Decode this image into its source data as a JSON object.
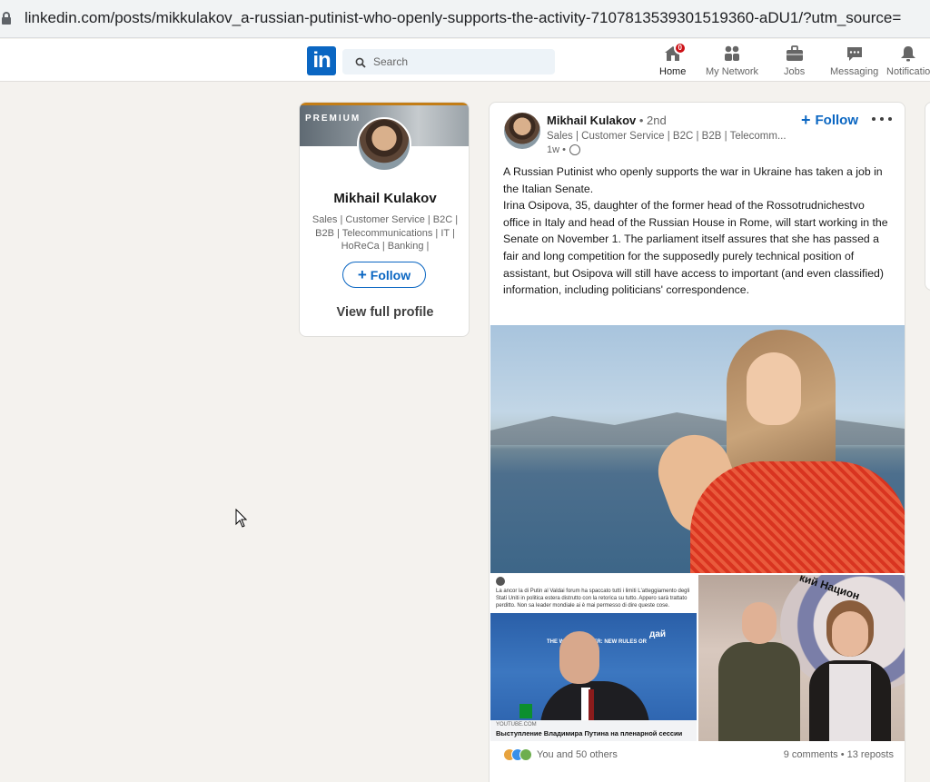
{
  "browser": {
    "url": "linkedin.com/posts/mikkulakov_a-russian-putinist-who-openly-supports-the-activity-7107813539301519360-aDU1/?utm_source="
  },
  "nav": {
    "logo": "in",
    "search_placeholder": "Search",
    "items": [
      {
        "label": "Home",
        "icon": "home-icon",
        "badge": "0"
      },
      {
        "label": "My Network",
        "icon": "network-icon"
      },
      {
        "label": "Jobs",
        "icon": "briefcase-icon"
      },
      {
        "label": "Messaging",
        "icon": "messaging-icon"
      },
      {
        "label": "Notificatio",
        "icon": "bell-icon"
      }
    ]
  },
  "profile_card": {
    "badge": "PREMIUM",
    "name": "Mikhail Kulakov",
    "headline": "Sales | Customer Service | B2C | B2B | Telecommunications | IT | HoReCa | Banking |",
    "follow": "Follow",
    "view_profile": "View full profile"
  },
  "post": {
    "author": "Mikhail Kulakov",
    "degree": "• 2nd",
    "headline": "Sales | Customer Service | B2C | B2B | Telecomm...",
    "time": "1w •",
    "follow": "Follow",
    "text_p1": "A Russian Putinist who openly supports the war in Ukraine has taken a job in the Italian Senate.",
    "text_p2": "Irina Osipova, 35, daughter of the former head of the Rossotrudnichestvo office in Italy and head of the Russian House in Rome, will start working in the Senate on November 1. The parliament itself assures that she has passed a fair and long competition for the supposedly purely technical position of assistant, but Osipova will still have access to important (and even classified) information, including politicians' correspondence.",
    "image2_text": "La ancor la di Putin al Valdai forum ha spaccato tutti i limiti L'atteggiamento degli Stati Uniti in politica estera distrutto con la retorica su tutto. Appero sarà trattato perditto. Non sa leader mondiale ai è mai permesso di dire queste cose.",
    "image2_banner": "THE WORLD ORDER: NEW RULES OR",
    "image2_banner_ru": "дай",
    "image2_source": "YOUTUBE.COM",
    "image2_caption": "Выступление Владимира Путина на пленарной сессии",
    "image3_sign": "кий Национ",
    "reactions_text": "You and 50 others",
    "stats": "9 comments • 13 reposts"
  }
}
